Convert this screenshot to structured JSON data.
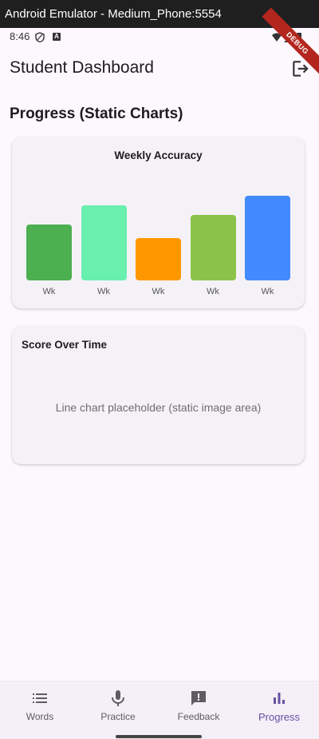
{
  "window": {
    "title": "Android Emulator - Medium_Phone:5554"
  },
  "status_bar": {
    "time": "8:46"
  },
  "debug_banner": "DEBUG",
  "appbar": {
    "title": "Student Dashboard",
    "logout_icon": "logout-icon"
  },
  "section": {
    "title": "Progress (Static Charts)"
  },
  "weekly_card": {
    "title": "Weekly Accuracy"
  },
  "score_card": {
    "title": "Score Over Time",
    "placeholder": "Line chart placeholder (static image area)"
  },
  "chart_data": {
    "type": "bar",
    "title": "Weekly Accuracy",
    "categories": [
      "Wk",
      "Wk",
      "Wk",
      "Wk",
      "Wk"
    ],
    "values": [
      70,
      94,
      53,
      82,
      106
    ],
    "colors": [
      "#4caf50",
      "#69f0ae",
      "#ff9800",
      "#8bc34a",
      "#448aff"
    ],
    "xlabel": "",
    "ylabel": "",
    "grid": false
  },
  "bottom_nav": {
    "items": [
      {
        "label": "Words",
        "icon": "list-icon",
        "active": false
      },
      {
        "label": "Practice",
        "icon": "microphone-icon",
        "active": false
      },
      {
        "label": "Feedback",
        "icon": "feedback-icon",
        "active": false
      },
      {
        "label": "Progress",
        "icon": "bar-chart-icon",
        "active": true
      }
    ]
  }
}
